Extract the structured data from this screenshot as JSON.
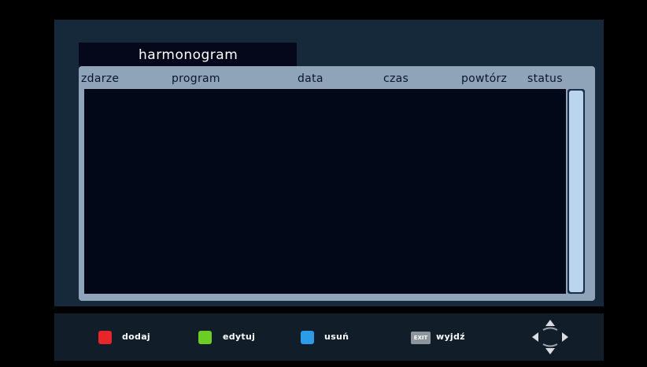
{
  "title": "harmonogram",
  "columns": [
    "zdarze",
    "program",
    "data",
    "czas",
    "powtórz",
    "status"
  ],
  "rows": [],
  "footer": {
    "add_label": "dodaj",
    "edit_label": "edytuj",
    "delete_label": "usuń",
    "exit_key_label": "EXIT",
    "exit_label": "wyjdź"
  },
  "colors": {
    "red_key": "#e8262a",
    "green_key": "#6ccd25",
    "blue_key": "#2c9be8"
  },
  "icons": {
    "navigation": "directional-pad-icon"
  }
}
